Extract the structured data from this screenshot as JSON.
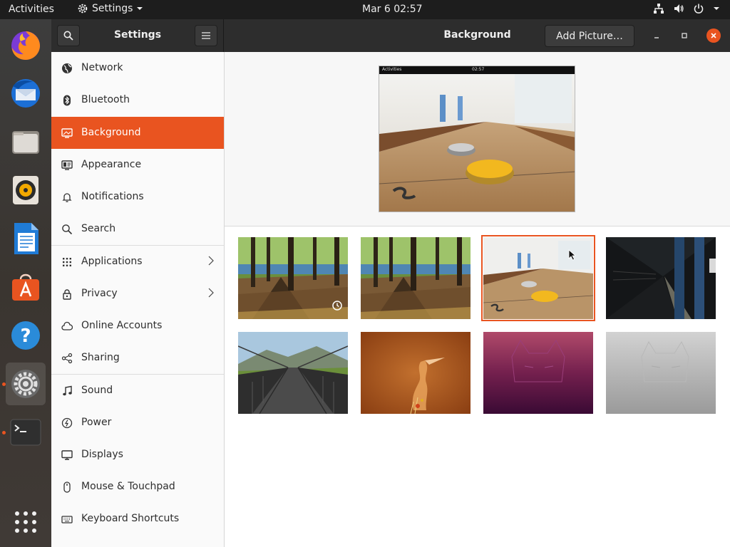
{
  "topbar": {
    "activities": "Activities",
    "app_menu": "Settings",
    "clock": "Mar 6  02:57"
  },
  "headerbar": {
    "left_title": "Settings",
    "title": "Background",
    "add_picture": "Add Picture…"
  },
  "sidebar": {
    "items": [
      {
        "label": "Network",
        "icon": "network-icon"
      },
      {
        "label": "Bluetooth",
        "icon": "bluetooth-icon"
      },
      {
        "label": "Background",
        "icon": "background-icon",
        "selected": true
      },
      {
        "label": "Appearance",
        "icon": "appearance-icon"
      },
      {
        "label": "Notifications",
        "icon": "bell-icon"
      },
      {
        "label": "Search",
        "icon": "search-icon"
      },
      {
        "label": "Applications",
        "icon": "grid-icon",
        "chevron": true
      },
      {
        "label": "Privacy",
        "icon": "lock-icon",
        "chevron": true
      },
      {
        "label": "Online Accounts",
        "icon": "cloud-icon"
      },
      {
        "label": "Sharing",
        "icon": "share-icon"
      },
      {
        "label": "Sound",
        "icon": "music-note-icon"
      },
      {
        "label": "Power",
        "icon": "power-icon"
      },
      {
        "label": "Displays",
        "icon": "display-icon"
      },
      {
        "label": "Mouse & Touchpad",
        "icon": "mouse-icon"
      },
      {
        "label": "Keyboard Shortcuts",
        "icon": "keyboard-icon"
      }
    ]
  },
  "preview": {
    "mini_activities": "Activities",
    "mini_clock": "02:57"
  },
  "colors": {
    "accent": "#e95420",
    "headerbar": "#2d2d2d",
    "topbar": "#1d1d1d"
  }
}
